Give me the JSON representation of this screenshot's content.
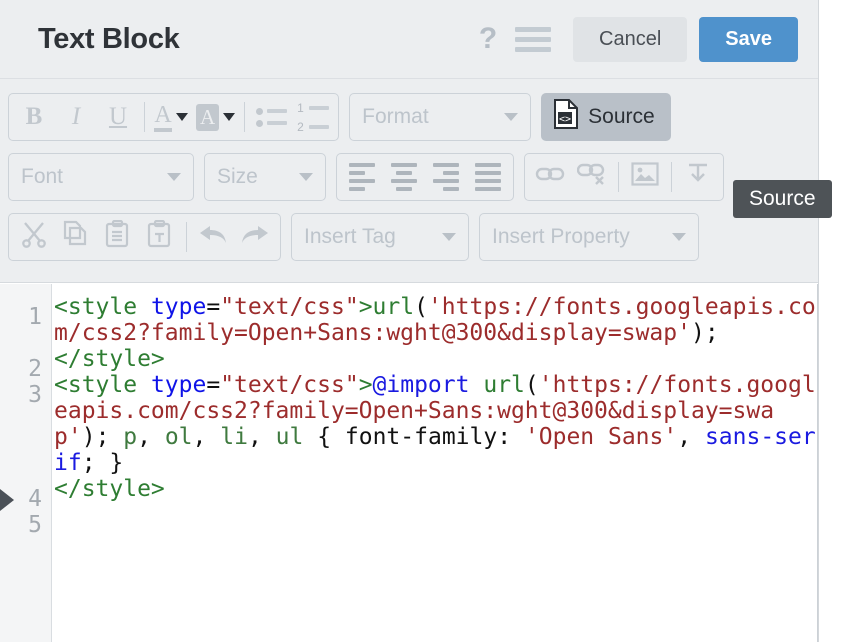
{
  "header": {
    "title": "Text Block",
    "help_icon": "question-mark-icon",
    "menu_icon": "hamburger-menu-icon",
    "cancel_label": "Cancel",
    "save_label": "Save",
    "save_color": "#4f92cc",
    "cancel_color": "#e0e3e6"
  },
  "toolbar": {
    "row1": {
      "bold": "B",
      "italic": "I",
      "underline": "U",
      "text_color": "A",
      "bg_color": "A",
      "bulleted_list": "bulleted-list-icon",
      "numbered_list": "numbered-list-icon",
      "format_label": "Format",
      "source_label": "Source"
    },
    "row2": {
      "font_label": "Font",
      "size_label": "Size",
      "align_left": "align-left-icon",
      "align_center": "align-center-icon",
      "align_right": "align-right-icon",
      "align_justify": "align-justify-icon",
      "link": "link-icon",
      "unlink": "unlink-icon",
      "image": "image-icon",
      "anchor": "anchor-icon"
    },
    "row3": {
      "cut": "scissors-icon",
      "copy": "copy-icon",
      "paste": "paste-icon",
      "paste_text": "paste-as-text-icon",
      "undo": "undo-arrow-icon",
      "redo": "redo-arrow-icon",
      "insert_tag_label": "Insert Tag",
      "insert_property_label": "Insert Property"
    }
  },
  "tooltip": {
    "text": "Source",
    "background": "#4e5357"
  },
  "editor": {
    "line_numbers": [
      "1",
      "2",
      "3",
      "4",
      "5"
    ],
    "lines": [
      {
        "number": "1",
        "tokens": [
          {
            "t": "<style",
            "c": "tag"
          },
          {
            "t": " ",
            "c": "plain"
          },
          {
            "t": "type",
            "c": "attr"
          },
          {
            "t": "=",
            "c": "plain"
          },
          {
            "t": "\"text/css\"",
            "c": "str"
          },
          {
            "t": ">",
            "c": "tag"
          },
          {
            "t": "url",
            "c": "fn"
          },
          {
            "t": "(",
            "c": "plain"
          },
          {
            "t": "'https://fonts.googleapis.com/css2?family=Open+Sans:wght@300&display=swap'",
            "c": "str"
          },
          {
            "t": ")",
            "c": "plain"
          },
          {
            "t": ";",
            "c": "plain"
          }
        ]
      },
      {
        "number": "2",
        "tokens": [
          {
            "t": "</style>",
            "c": "tag"
          }
        ]
      },
      {
        "number": "3",
        "tokens": [
          {
            "t": "<style",
            "c": "tag"
          },
          {
            "t": " ",
            "c": "plain"
          },
          {
            "t": "type",
            "c": "attr"
          },
          {
            "t": "=",
            "c": "plain"
          },
          {
            "t": "\"text/css\"",
            "c": "str"
          },
          {
            "t": ">",
            "c": "tag"
          },
          {
            "t": "@import",
            "c": "kw"
          },
          {
            "t": " ",
            "c": "plain"
          },
          {
            "t": "url",
            "c": "fn"
          },
          {
            "t": "(",
            "c": "plain"
          },
          {
            "t": "'https://fonts.googleapis.com/css2?family=Open+Sans:wght@300&display=swap'",
            "c": "str"
          },
          {
            "t": ")",
            "c": "plain"
          },
          {
            "t": "; ",
            "c": "plain"
          },
          {
            "t": "p",
            "c": "sel"
          },
          {
            "t": ", ",
            "c": "plain"
          },
          {
            "t": "ol",
            "c": "sel"
          },
          {
            "t": ", ",
            "c": "plain"
          },
          {
            "t": "li",
            "c": "sel"
          },
          {
            "t": ", ",
            "c": "plain"
          },
          {
            "t": "ul",
            "c": "sel"
          },
          {
            "t": " { font-family: ",
            "c": "plain"
          },
          {
            "t": "'Open Sans'",
            "c": "str"
          },
          {
            "t": ", ",
            "c": "plain"
          },
          {
            "t": "sans-serif",
            "c": "kw"
          },
          {
            "t": "; }",
            "c": "plain"
          }
        ]
      },
      {
        "number": "4",
        "tokens": [
          {
            "t": "</style>",
            "c": "tag"
          }
        ]
      },
      {
        "number": "5",
        "tokens": []
      }
    ],
    "cursor_line": "4",
    "colors": {
      "tag": "#2e7d32",
      "attribute": "#0f13e8",
      "string": "#9c2c2c",
      "keyword": "#1a1ae0",
      "selector": "#3f7a3f",
      "plain": "#111111",
      "gutter_text": "#a3a9af",
      "gutter_bg": "#f4f5f6"
    }
  }
}
